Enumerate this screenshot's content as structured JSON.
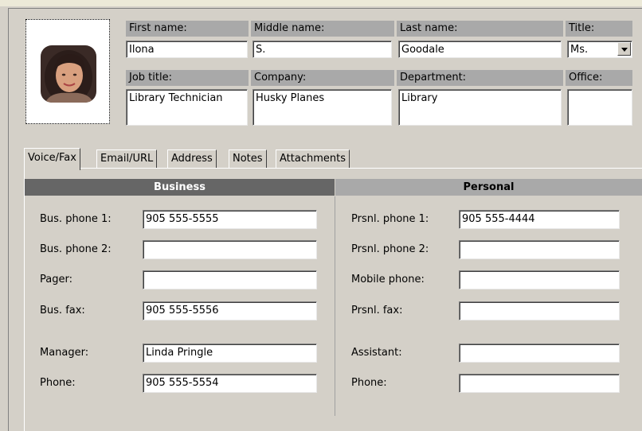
{
  "contact": {
    "first_name_label": "First name:",
    "first_name": "Ilona",
    "middle_name_label": "Middle name:",
    "middle_name": "S.",
    "last_name_label": "Last name:",
    "last_name": "Goodale",
    "title_label": "Title:",
    "title": "Ms.",
    "job_title_label": "Job title:",
    "job_title": "Library Technician",
    "company_label": "Company:",
    "company": "Husky Planes",
    "department_label": "Department:",
    "department": "Library",
    "office_label": "Office:",
    "office": ""
  },
  "tabs": [
    {
      "label": "Voice/Fax",
      "active": true
    },
    {
      "label": "Email/URL",
      "active": false
    },
    {
      "label": "Address",
      "active": false
    },
    {
      "label": "Notes",
      "active": false
    },
    {
      "label": "Attachments",
      "active": false
    }
  ],
  "business": {
    "header": "Business",
    "bus_phone1_label": "Bus. phone 1:",
    "bus_phone1": "905 555-5555",
    "bus_phone2_label": "Bus. phone 2:",
    "bus_phone2": "",
    "pager_label": "Pager:",
    "pager": "",
    "bus_fax_label": "Bus. fax:",
    "bus_fax": "905 555-5556",
    "manager_label": "Manager:",
    "manager": "Linda Pringle",
    "phone_label": "Phone:",
    "phone": "905 555-5554"
  },
  "personal": {
    "header": "Personal",
    "prsnl_phone1_label": "Prsnl. phone 1:",
    "prsnl_phone1": "905 555-4444",
    "prsnl_phone2_label": "Prsnl. phone 2:",
    "prsnl_phone2": "",
    "mobile_label": "Mobile phone:",
    "mobile": "",
    "prsnl_fax_label": "Prsnl. fax:",
    "prsnl_fax": "",
    "assistant_label": "Assistant:",
    "assistant": "",
    "phone_label": "Phone:",
    "phone": ""
  },
  "colors": {
    "background": "#d4d0c8",
    "header_dark": "#666666",
    "header_light": "#a9a9a9"
  },
  "icons": {
    "contact_photo": "person-photo",
    "title_dropdown": "chevron-down-icon"
  }
}
